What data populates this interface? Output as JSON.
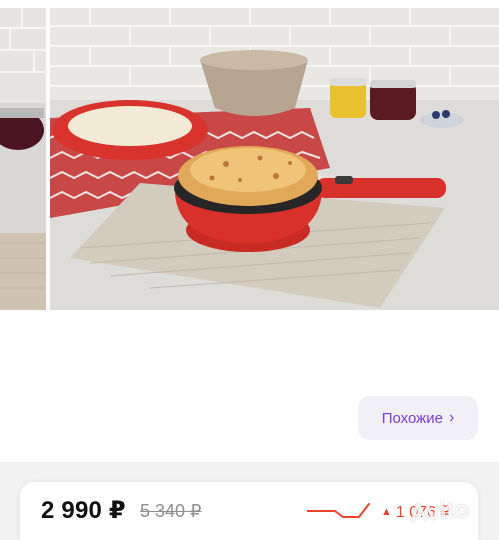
{
  "gallery": {
    "image_subject": "red electric crepe maker with a pancake"
  },
  "similar": {
    "label": "Похожие",
    "chevron": "›"
  },
  "price_bar": {
    "price": "2 990 ₽",
    "old_price": "5 340 ₽",
    "change_arrow": "▲",
    "change": "1 076 ₽",
    "trend_color": "#e8432e"
  },
  "watermark": "Avito"
}
